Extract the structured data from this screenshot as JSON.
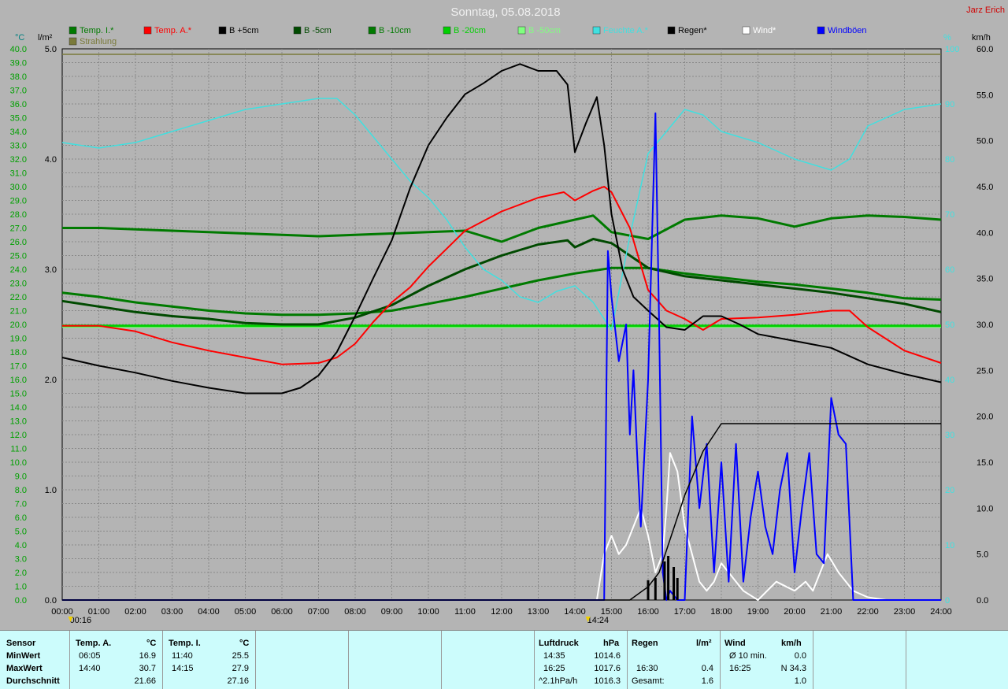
{
  "title": "Sonntag, 05.08.2018",
  "author": "Jarz Erich",
  "axes": {
    "left_unit_temp": "°C",
    "left_unit_rain": "l/m²",
    "right_unit_pct": "%",
    "right_unit_wind": "km/h"
  },
  "legend": [
    {
      "label": "Temp. I.*",
      "color": "#007a00"
    },
    {
      "label": "Temp. A.*",
      "color": "#ff0000"
    },
    {
      "label": "B +5cm",
      "color": "#000000"
    },
    {
      "label": "B -5cm",
      "color": "#004a00"
    },
    {
      "label": "B -10cm",
      "color": "#007a00"
    },
    {
      "label": "B -20cm",
      "color": "#00d000"
    },
    {
      "label": "B -50cm",
      "color": "#80ff80"
    },
    {
      "label": "Feuchte A.*",
      "color": "#40e0e0"
    },
    {
      "label": "Regen*",
      "color": "#000000"
    },
    {
      "label": "Wind*",
      "color": "#ffffff"
    },
    {
      "label": "Windböen",
      "color": "#0000ff"
    },
    {
      "label": "Strahlung",
      "color": "#7a7a3a"
    }
  ],
  "markers": {
    "sunrise": "00:16",
    "sunset": "14:24"
  },
  "chart_data": {
    "type": "line",
    "x_range": [
      "00:00",
      "24:00"
    ],
    "x_ticks": [
      "00:00",
      "01:00",
      "02:00",
      "03:00",
      "04:00",
      "05:00",
      "06:00",
      "07:00",
      "08:00",
      "09:00",
      "10:00",
      "11:00",
      "12:00",
      "13:00",
      "14:00",
      "15:00",
      "16:00",
      "17:00",
      "18:00",
      "19:00",
      "20:00",
      "21:00",
      "22:00",
      "23:00",
      "24:00"
    ],
    "temp_axis": {
      "min": 0.0,
      "max": 40.0,
      "step": 1.0
    },
    "rain_axis": {
      "min": 0.0,
      "max": 5.0,
      "ticks": [
        "0.0",
        "1.0",
        "2.0",
        "3.0",
        "4.0",
        "5.0"
      ]
    },
    "pct_axis": {
      "min": 0,
      "max": 100,
      "ticks": [
        "0",
        "10",
        "20",
        "30",
        "40",
        "50",
        "60",
        "70",
        "80",
        "90",
        "100"
      ]
    },
    "wind_axis": {
      "min": 0.0,
      "max": 60.0,
      "ticks": [
        "0.0",
        "5.0",
        "10.0",
        "15.0",
        "20.0",
        "25.0",
        "30.0",
        "35.0",
        "40.0",
        "45.0",
        "50.0",
        "55.0",
        "60.0"
      ]
    },
    "grid": true,
    "series": [
      {
        "name": "Temp. A.*",
        "axis": "temp",
        "color": "#ff0000",
        "x": [
          0,
          1,
          2,
          3,
          4,
          5,
          6,
          7,
          7.5,
          8,
          8.5,
          9,
          9.5,
          10,
          10.5,
          11,
          12,
          13,
          13.7,
          14,
          14.5,
          14.8,
          15,
          15.5,
          16,
          16.5,
          17,
          17.5,
          18,
          19,
          20,
          21,
          21.5,
          22,
          23,
          24
        ],
        "y": [
          19.9,
          19.9,
          19.5,
          18.7,
          18.1,
          17.6,
          17.1,
          17.2,
          17.6,
          18.6,
          20.2,
          21.6,
          22.7,
          24.2,
          25.5,
          26.8,
          28.2,
          29.2,
          29.6,
          29.0,
          29.7,
          30.0,
          29.6,
          27.0,
          22.5,
          21.0,
          20.4,
          19.6,
          20.4,
          20.5,
          20.7,
          21.0,
          21.0,
          19.8,
          18.1,
          17.2
        ]
      },
      {
        "name": "Temp. I.*",
        "axis": "temp",
        "color": "#007a00",
        "x": [
          0,
          1,
          2,
          3,
          4,
          5,
          6,
          7,
          8,
          9,
          10,
          11,
          12,
          13,
          14,
          14.5,
          15,
          16,
          17,
          18,
          19,
          20,
          21,
          22,
          23,
          24
        ],
        "y": [
          27.0,
          27.0,
          26.9,
          26.8,
          26.7,
          26.6,
          26.5,
          26.4,
          26.5,
          26.6,
          26.7,
          26.8,
          26.0,
          27.0,
          27.6,
          27.9,
          26.7,
          26.2,
          27.6,
          27.9,
          27.7,
          27.1,
          27.7,
          27.9,
          27.8,
          27.6
        ]
      },
      {
        "name": "B +5cm",
        "axis": "temp",
        "color": "#000000",
        "x": [
          0,
          1,
          2,
          3,
          4,
          5,
          6,
          6.5,
          7,
          7.5,
          8,
          8.5,
          9,
          9.5,
          10,
          10.5,
          11,
          11.5,
          12,
          12.5,
          13,
          13.5,
          13.8,
          14,
          14.3,
          14.6,
          14.8,
          15,
          15.3,
          15.6,
          16,
          16.5,
          17,
          17.5,
          18,
          18.5,
          19,
          20,
          21,
          22,
          23,
          24
        ],
        "y": [
          17.6,
          17.0,
          16.5,
          15.9,
          15.4,
          15.0,
          15.0,
          15.4,
          16.3,
          18.0,
          20.6,
          23.4,
          26.1,
          29.9,
          33.0,
          35.0,
          36.7,
          37.5,
          38.4,
          38.9,
          38.4,
          38.4,
          37.4,
          32.5,
          34.6,
          36.5,
          33.0,
          28.0,
          24.0,
          22.0,
          21.0,
          19.8,
          19.6,
          20.6,
          20.6,
          20.0,
          19.3,
          18.8,
          18.3,
          17.1,
          16.4,
          15.8
        ]
      },
      {
        "name": "B -5cm",
        "axis": "temp",
        "color": "#004a00",
        "x": [
          0,
          1,
          2,
          3,
          4,
          5,
          6,
          7,
          8,
          9,
          10,
          11,
          12,
          13,
          13.8,
          14,
          14.5,
          15,
          15.5,
          16,
          17,
          18,
          19,
          20,
          21,
          22,
          23,
          24
        ],
        "y": [
          21.7,
          21.3,
          20.9,
          20.6,
          20.4,
          20.1,
          20.0,
          20.0,
          20.5,
          21.4,
          22.8,
          24.0,
          25.0,
          25.8,
          26.1,
          25.6,
          26.2,
          25.9,
          25.0,
          24.1,
          23.5,
          23.2,
          22.9,
          22.6,
          22.3,
          21.9,
          21.5,
          20.9
        ]
      },
      {
        "name": "B -10cm",
        "axis": "temp",
        "color": "#007a00",
        "x": [
          0,
          1,
          2,
          3,
          4,
          5,
          6,
          7,
          8,
          9,
          10,
          11,
          12,
          13,
          14,
          15,
          16,
          17,
          18,
          19,
          20,
          21,
          22,
          23,
          24
        ],
        "y": [
          22.3,
          22.0,
          21.6,
          21.3,
          21.0,
          20.8,
          20.7,
          20.7,
          20.8,
          21.0,
          21.5,
          22.0,
          22.6,
          23.2,
          23.7,
          24.1,
          24.1,
          23.7,
          23.4,
          23.1,
          22.9,
          22.6,
          22.3,
          21.9,
          21.8
        ]
      },
      {
        "name": "B -20cm",
        "axis": "temp",
        "color": "#00d000",
        "x": [
          0,
          6,
          12,
          18,
          24
        ],
        "y": [
          19.9,
          19.9,
          19.9,
          19.9,
          19.9
        ]
      },
      {
        "name": "B -50cm",
        "axis": "temp",
        "color": "#80ff80",
        "x": [
          0,
          24
        ],
        "y": [
          19.8,
          19.8
        ]
      },
      {
        "name": "Feuchte A.*",
        "axis": "pct",
        "color": "#40e0e0",
        "x": [
          0,
          1,
          2,
          3,
          4,
          5,
          6,
          7,
          7.5,
          8,
          8.5,
          9,
          9.5,
          10,
          10.5,
          11,
          11.5,
          12,
          12.5,
          13,
          13.5,
          14,
          14.5,
          14.8,
          15,
          15.5,
          16,
          16.5,
          17,
          17.5,
          18,
          19,
          20,
          21,
          21.5,
          22,
          23,
          24
        ],
        "y": [
          83,
          82,
          83,
          85,
          87,
          89,
          90,
          91,
          91,
          88,
          84,
          80,
          76,
          73,
          69,
          64,
          60,
          58,
          55,
          54,
          56,
          57,
          54,
          51,
          49,
          66,
          81,
          85,
          89,
          88,
          85,
          83,
          80,
          78,
          80,
          86,
          89,
          90
        ]
      },
      {
        "name": "Regen*",
        "axis": "rain",
        "color": "#000000",
        "x": [
          0,
          15.5,
          16,
          16.3,
          16.6,
          17,
          17.5,
          18,
          24
        ],
        "y": [
          0,
          0,
          0.12,
          0.25,
          0.55,
          0.95,
          1.35,
          1.6,
          1.6
        ]
      },
      {
        "name": "Wind*",
        "axis": "wind",
        "color": "#ffffff",
        "x": [
          0,
          14.6,
          14.8,
          15,
          15.2,
          15.4,
          15.6,
          15.8,
          16,
          16.2,
          16.4,
          16.5,
          16.6,
          16.8,
          17,
          17.2,
          17.4,
          17.6,
          17.8,
          18,
          18.2,
          18.4,
          18.6,
          18.8,
          19,
          19.5,
          20,
          20.3,
          20.5,
          20.7,
          20.9,
          21.2,
          21.6,
          22,
          22.5,
          24
        ],
        "y": [
          0,
          0,
          5,
          7,
          5,
          6,
          8,
          10,
          7,
          3,
          5,
          10,
          16,
          14,
          8,
          5,
          2,
          1,
          2,
          4,
          3,
          2,
          1,
          0.5,
          0,
          2,
          1,
          2,
          1,
          3,
          5,
          3,
          1,
          0.3,
          0,
          0
        ]
      },
      {
        "name": "Windböen",
        "axis": "wind",
        "color": "#0000ff",
        "x": [
          0,
          14.8,
          14.9,
          15,
          15.2,
          15.4,
          15.5,
          15.6,
          15.7,
          15.8,
          16,
          16.2,
          16.3,
          16.4,
          16.5,
          16.6,
          16.8,
          17,
          17.2,
          17.4,
          17.6,
          17.8,
          18,
          18.2,
          18.4,
          18.6,
          18.8,
          19,
          19.2,
          19.4,
          19.6,
          19.8,
          20,
          20.2,
          20.4,
          20.6,
          20.8,
          21,
          21.2,
          21.4,
          21.6,
          22,
          24
        ],
        "y": [
          0,
          0,
          38,
          33,
          26,
          30,
          18,
          25,
          16,
          8,
          24,
          53,
          30,
          3,
          0,
          1,
          0,
          0,
          20,
          10,
          17,
          3,
          15,
          2,
          17,
          2,
          9,
          14,
          8,
          5,
          12,
          16,
          3,
          10,
          16,
          5,
          4,
          22,
          18,
          17,
          0,
          0,
          0
        ]
      },
      {
        "name": "Strahlung",
        "axis": "pct",
        "color": "#7a7a3a",
        "x": [
          0,
          24
        ],
        "y": [
          99,
          99
        ]
      }
    ]
  },
  "footer": {
    "sensor_col": {
      "header": "Sensor",
      "rows": [
        "MinWert",
        "MaxWert",
        "Durchschnitt"
      ]
    },
    "temp_a": {
      "header": "Temp. A.",
      "unit": "°C",
      "rows": [
        {
          "time": "06:05",
          "value": "16.9"
        },
        {
          "time": "14:40",
          "value": "30.7"
        },
        {
          "time": "",
          "value": "21.66"
        }
      ]
    },
    "temp_i": {
      "header": "Temp. I.",
      "unit": "°C",
      "rows": [
        {
          "time": "11:40",
          "value": "25.5"
        },
        {
          "time": "14:15",
          "value": "27.9"
        },
        {
          "time": "",
          "value": "27.16"
        }
      ]
    },
    "luftdruck": {
      "header": "Luftdruck",
      "unit": "hPa",
      "rows": [
        {
          "time": "14:35",
          "value": "1014.6"
        },
        {
          "time": "16:25",
          "value": "1017.6"
        },
        {
          "time": "^2.1hPa/h",
          "value": "1016.3"
        }
      ]
    },
    "regen": {
      "header": "Regen",
      "unit": "l/m²",
      "rows": [
        {
          "time": "",
          "value": ""
        },
        {
          "time": "16:30",
          "value": "0.4"
        },
        {
          "time": "Gesamt:",
          "value": "1.6"
        }
      ]
    },
    "wind": {
      "header": "Wind",
      "unit": "km/h",
      "rows": [
        {
          "time": "Ø 10 min.",
          "value": "0.0"
        },
        {
          "time": "16:25",
          "value": "N 34.3"
        },
        {
          "time": "",
          "value": "1.0"
        }
      ]
    }
  }
}
